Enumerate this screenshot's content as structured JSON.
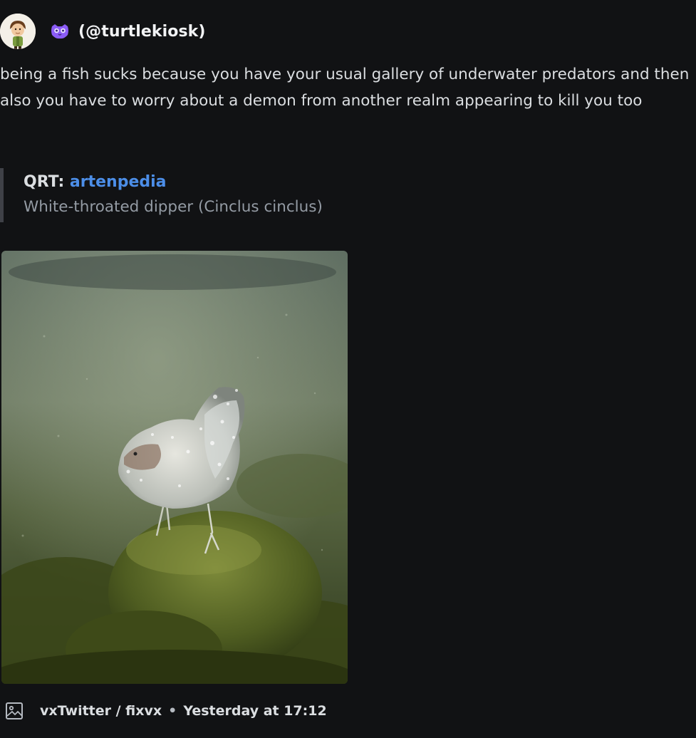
{
  "post": {
    "author_handle": "(@turtlekiosk)",
    "text": "being a fish sucks because you have your usual gallery of underwater predators and then also you have to worry about a demon from another realm appearing to kill you too"
  },
  "quote": {
    "prefix": "QRT: ",
    "link_text": "artenpedia",
    "text": "White-throated dipper (Cinclus cinclus)"
  },
  "footer": {
    "source": "vxTwitter / fixvx",
    "separator": "•",
    "timestamp": "Yesterday at 17:12"
  },
  "icons": {
    "author_icon": "purple-owl-face-icon",
    "footer_icon": "image-icon"
  },
  "colors": {
    "background": "#111214",
    "link": "#4c8ee8",
    "quote_bar": "#3f4147",
    "author_icon": "#8b5cf6"
  }
}
